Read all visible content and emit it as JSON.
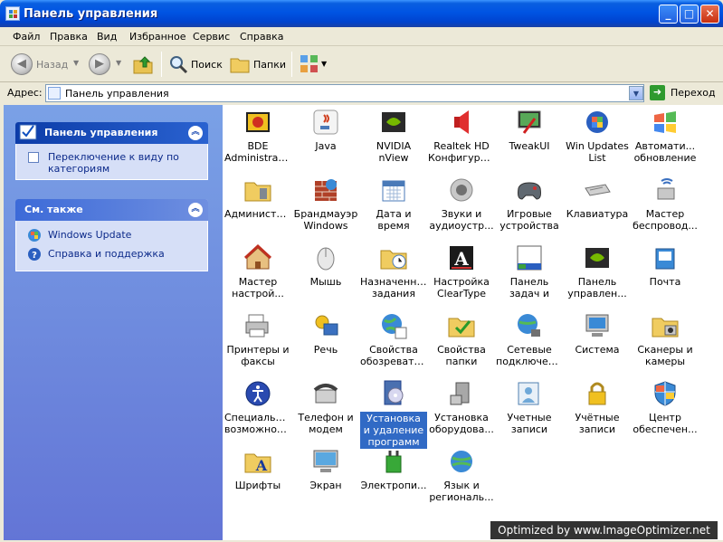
{
  "window": {
    "title": "Панель управления",
    "controls": {
      "minimize": "_",
      "maximize": "□",
      "close": "✕"
    }
  },
  "menu": [
    "Файл",
    "Правка",
    "Вид",
    "Избранное",
    "Сервис",
    "Справка"
  ],
  "toolbar": {
    "back": "Назад",
    "search": "Поиск",
    "folders": "Папки"
  },
  "address": {
    "label": "Адрес:",
    "value": "Панель управления",
    "go": "Переход"
  },
  "left_pane": {
    "control_panel": {
      "title": "Панель управления",
      "switch_link": "Переключение к виду по категориям"
    },
    "see_also": {
      "title": "См. также",
      "links": [
        "Windows Update",
        "Справка и поддержка"
      ]
    }
  },
  "items": [
    [
      "BDE Administrator",
      "Java",
      "NVIDIA nView Desktop M...",
      "Realtek HD Конфигура...",
      "TweakUI",
      "Win Updates List",
      "Автомати... обновление"
    ],
    [
      "Администр...",
      "Брандмауэр Windows",
      "Дата и время",
      "Звуки и аудиоустр...",
      "Игровые устройства",
      "Клавиатура",
      "Мастер беспровод..."
    ],
    [
      "Мастер настрой...",
      "Мышь",
      "Назначенные задания",
      "Настройка ClearType",
      "Панель задач и меню \"Пуск\"",
      "Панель управлен...",
      "Почта"
    ],
    [
      "Принтеры и факсы",
      "Речь",
      "Свойства обозревателя",
      "Свойства папки",
      "Сетевые подключения",
      "Система",
      "Сканеры и камеры"
    ],
    [
      "Специальные возможности",
      "Телефон и модем",
      "Установка и удаление программ",
      "Установка оборудова...",
      "Учетные записи пол...",
      "Учётные записи пол...",
      "Центр обеспечен..."
    ],
    [
      "Шрифты",
      "Экран",
      "Электропи...",
      "Язык и региональ..."
    ]
  ],
  "item_icons": [
    [
      "bde-icon",
      "java-icon",
      "nvidia-icon",
      "realtek-speaker-icon",
      "tweakui-icon",
      "win-updates-icon",
      "windows-logo-icon"
    ],
    [
      "folder-tools-icon",
      "firewall-icon",
      "calendar-icon",
      "speaker-icon",
      "gamepad-icon",
      "keyboard-icon",
      "wireless-icon"
    ],
    [
      "house-icon",
      "mouse-icon",
      "folder-clock-icon",
      "cleartype-icon",
      "taskbar-icon",
      "nvidia-icon",
      "mail-icon"
    ],
    [
      "printer-icon",
      "speech-icon",
      "globe-icon",
      "folder-check-icon",
      "network-icon",
      "system-icon",
      "scanner-icon"
    ],
    [
      "accessibility-icon",
      "phone-icon",
      "cd-box-icon",
      "hardware-icon",
      "user-accounts-icon",
      "lock-icon",
      "security-shield-icon"
    ],
    [
      "fonts-folder-icon",
      "display-icon",
      "power-icon",
      "language-globe-icon"
    ]
  ],
  "selected_item": "Установка и удаление программ",
  "watermark": "Optimized by www.ImageOptimizer.net"
}
